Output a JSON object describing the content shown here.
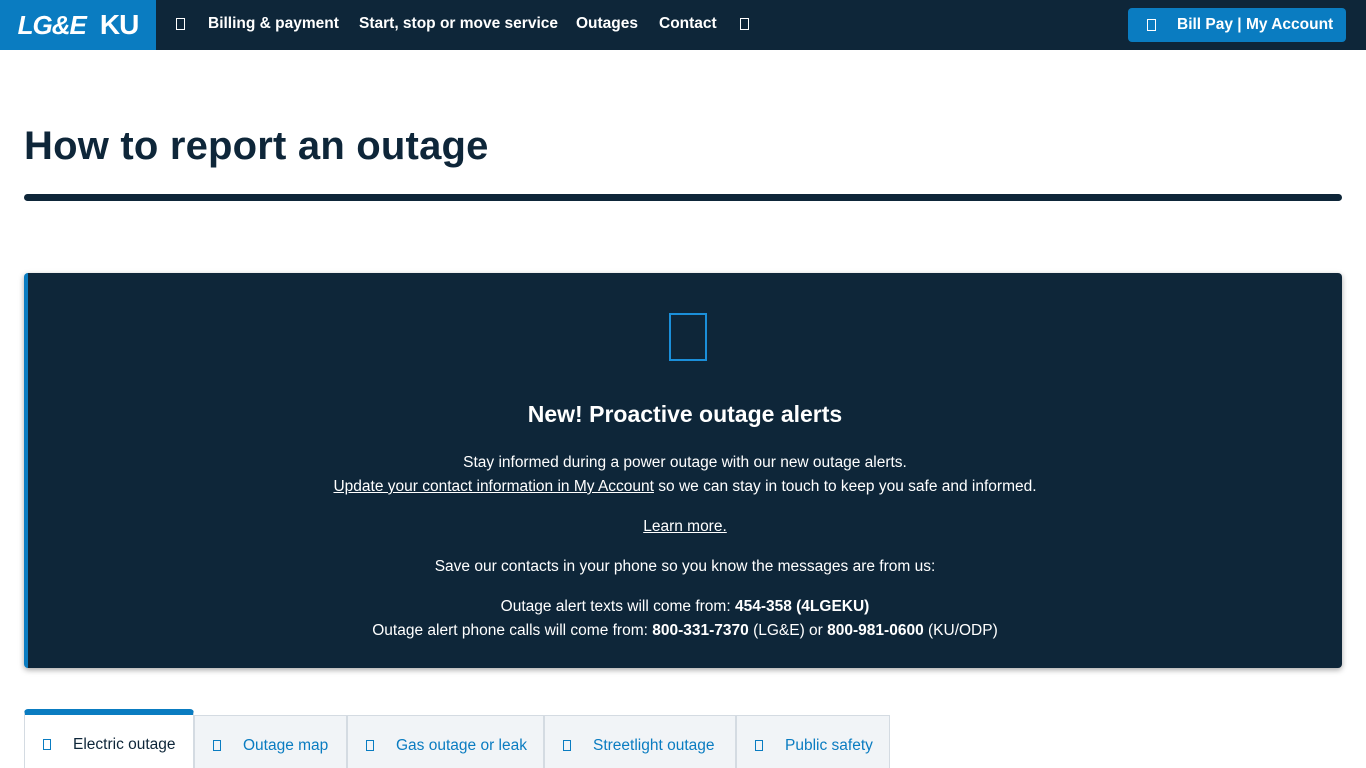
{
  "brand": {
    "logo_left": "LG&E",
    "logo_right": "KU"
  },
  "nav": {
    "menu_icon": "menu-icon",
    "items": [
      {
        "label": "Billing & payment"
      },
      {
        "label": "Start, stop or move service"
      },
      {
        "label": "Outages"
      },
      {
        "label": "Contact"
      }
    ],
    "search_icon": "search-icon",
    "account_button": {
      "label": "Bill Pay | My Account",
      "icon": "user-icon"
    }
  },
  "page": {
    "title": "How to report an outage"
  },
  "alert": {
    "icon": "mobile-phone-icon",
    "title": "New! Proactive outage alerts",
    "line1": "Stay informed during a power outage with our new outage alerts.",
    "update_link": "Update your contact information in My Account",
    "line2_rest": " so we can stay in touch to keep you safe and informed.",
    "learn_more": "Learn more.",
    "save_contacts": "Save our contacts in your phone so you know the messages are from us:",
    "texts_prefix": "Outage alert texts will come from: ",
    "texts_number": "454-358 (4LGEKU)",
    "calls_prefix": "Outage alert phone calls will come from: ",
    "calls_number_1": "800-331-7370",
    "calls_mid": " (LG&E) or ",
    "calls_number_2": "800-981-0600",
    "calls_suffix": " (KU/ODP)"
  },
  "tabs": [
    {
      "label": "Electric outage",
      "icon": "lightning-icon",
      "active": true
    },
    {
      "label": "Outage map",
      "icon": "map-icon",
      "active": false
    },
    {
      "label": "Gas outage or leak",
      "icon": "flame-icon",
      "active": false
    },
    {
      "label": "Streetlight outage",
      "icon": "streetlight-icon",
      "active": false
    },
    {
      "label": "Public safety",
      "icon": "warning-icon",
      "active": false
    }
  ],
  "colors": {
    "navy": "#0e2639",
    "brand_blue": "#0a7cc1",
    "white": "#ffffff"
  }
}
